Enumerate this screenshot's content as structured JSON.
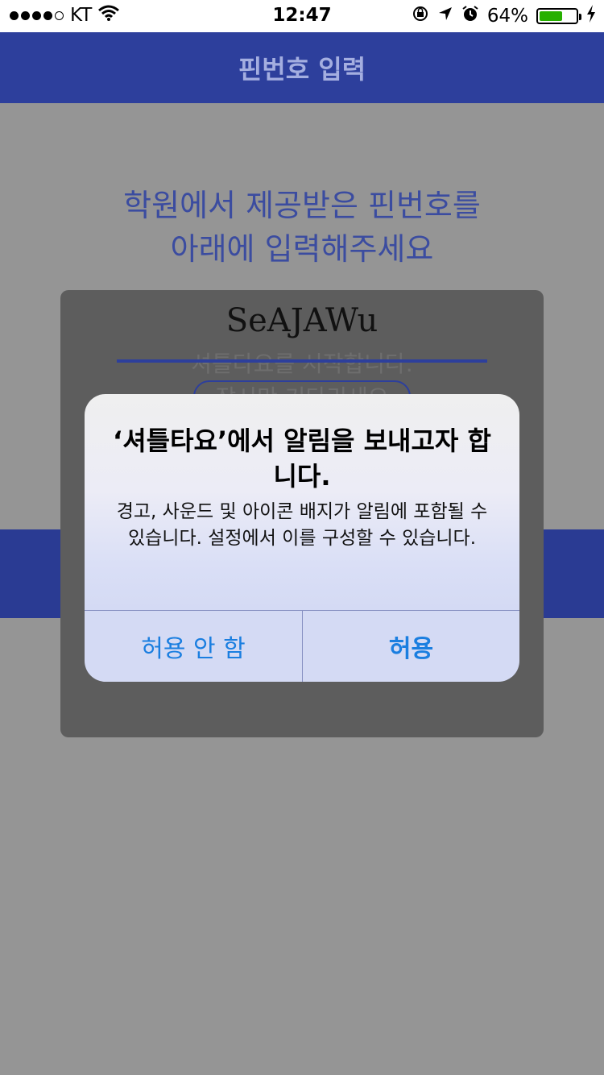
{
  "status_bar": {
    "carrier": "KT",
    "time": "12:47",
    "battery_percent_label": "64%",
    "battery_level": 0.64,
    "icons": [
      "signal-dots",
      "wifi-icon",
      "rotation-lock-icon",
      "location-arrow-icon",
      "alarm-icon",
      "battery-icon",
      "charging-bolt-icon"
    ]
  },
  "nav": {
    "title": "핀번호 입력"
  },
  "instruction": {
    "line1": "학원에서 제공받은 핀번호를",
    "line2": "아래에 입력해주세요"
  },
  "splash": {
    "app_name": "SeAJAWu",
    "message1": "셔틀타요를 시작합니다.",
    "message2": "잠시만 기다리세요"
  },
  "alert": {
    "title": "‘셔틀타요’에서 알림을 보내고자 합니다.",
    "message": "경고, 사운드 및 아이콘 배지가 알림에 포함될 수 있습니다. 설정에서 이를 구성할 수 있습니다.",
    "deny_label": "허용 안 함",
    "allow_label": "허용"
  },
  "colors": {
    "nav_bg": "#2d3f9c",
    "accent_text": "#3b4ca0",
    "alert_button": "#1a7ee0",
    "battery_fill": "#27b000"
  }
}
